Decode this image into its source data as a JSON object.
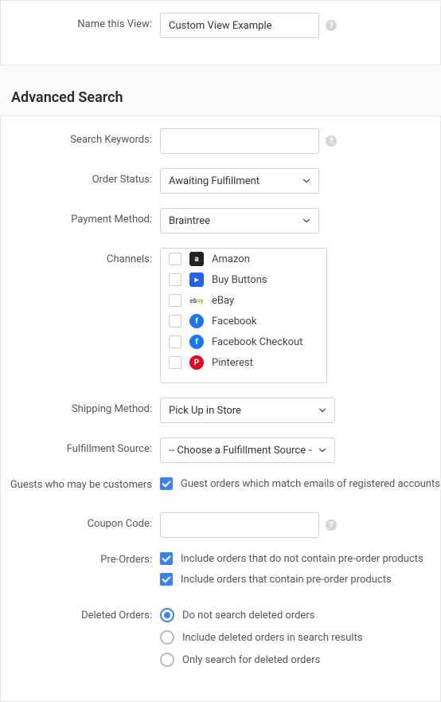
{
  "nameView": {
    "label": "Name this View:",
    "value": "Custom View Example"
  },
  "sectionTitle": "Advanced Search",
  "searchKeywords": {
    "label": "Search Keywords:",
    "value": ""
  },
  "orderStatus": {
    "label": "Order Status:",
    "selected": "Awaiting Fulfillment"
  },
  "paymentMethod": {
    "label": "Payment Method:",
    "selected": "Braintree"
  },
  "channels": {
    "label": "Channels:",
    "items": [
      {
        "name": "Amazon",
        "checked": false
      },
      {
        "name": "Buy Buttons",
        "checked": false
      },
      {
        "name": "eBay",
        "checked": false
      },
      {
        "name": "Facebook",
        "checked": false
      },
      {
        "name": "Facebook Checkout",
        "checked": false
      },
      {
        "name": "Pinterest",
        "checked": false
      }
    ]
  },
  "shippingMethod": {
    "label": "Shipping Method:",
    "selected": "Pick Up in Store"
  },
  "fulfillmentSource": {
    "label": "Fulfillment Source:",
    "selected": "-- Choose a Fulfillment Source --"
  },
  "guests": {
    "label": "Guests who may be customers",
    "optionLabel": "Guest orders which match emails of registered accounts",
    "checked": true
  },
  "couponCode": {
    "label": "Coupon Code:",
    "value": ""
  },
  "preOrders": {
    "label": "Pre-Orders:",
    "options": [
      {
        "label": "Include orders that do not contain pre-order products",
        "checked": true
      },
      {
        "label": "Include orders that contain pre-order products",
        "checked": true
      }
    ]
  },
  "deletedOrders": {
    "label": "Deleted Orders:",
    "options": [
      {
        "label": "Do not search deleted orders",
        "checked": true
      },
      {
        "label": "Include deleted orders in search results",
        "checked": false
      },
      {
        "label": "Only search for deleted orders",
        "checked": false
      }
    ]
  }
}
